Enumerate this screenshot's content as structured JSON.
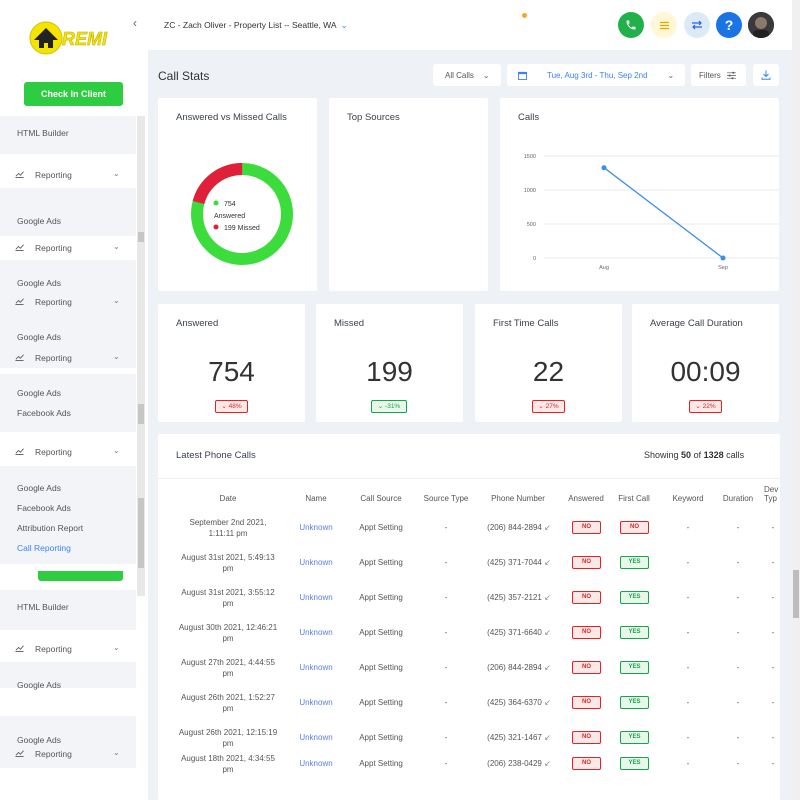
{
  "sidebar": {
    "logo_text": "REMI",
    "check_in_label": "Check In Client",
    "items": [
      {
        "type": "text",
        "label": "HTML Builder"
      },
      {
        "type": "report",
        "label": "Reporting"
      },
      {
        "type": "text",
        "label": "Google Ads"
      },
      {
        "type": "report",
        "label": "Reporting"
      },
      {
        "type": "text",
        "label": "Google Ads"
      },
      {
        "type": "report",
        "label": "Reporting"
      },
      {
        "type": "text",
        "label": "Google Ads"
      },
      {
        "type": "report",
        "label": "Reporting"
      },
      {
        "type": "text",
        "label": "Google Ads"
      },
      {
        "type": "text",
        "label": "Facebook Ads"
      },
      {
        "type": "report",
        "label": "Reporting"
      },
      {
        "type": "text",
        "label": "Google Ads"
      },
      {
        "type": "text",
        "label": "Facebook Ads"
      },
      {
        "type": "text",
        "label": "Attribution Report"
      },
      {
        "type": "text",
        "label": "Call Reporting",
        "active": true
      },
      {
        "type": "text",
        "label": "HTML Builder"
      },
      {
        "type": "report",
        "label": "Reporting"
      },
      {
        "type": "text",
        "label": "Google Ads"
      },
      {
        "type": "text",
        "label": "Google Ads"
      },
      {
        "type": "report",
        "label": "Reporting"
      }
    ]
  },
  "header": {
    "breadcrumb": "ZC - Zach Oliver - Property List -- Seattle, WA",
    "help_label": "?"
  },
  "page": {
    "title": "Call Stats",
    "calls_filter": "All Calls",
    "date_range": "Tue, Aug 3rd - Thu, Sep 2nd",
    "filters_label": "Filters"
  },
  "cards": {
    "answered_vs_missed": {
      "title": "Answered vs Missed Calls",
      "answered_count": "754",
      "answered_label": "Answered",
      "missed_label": "199 Missed",
      "answered_value": 754,
      "missed_value": 199,
      "answered_color": "#3ddc3d",
      "missed_color": "#e0203a"
    },
    "top_sources": {
      "title": "Top Sources"
    },
    "calls": {
      "title": "Calls"
    }
  },
  "chart_data": {
    "type": "line",
    "title": "Calls",
    "x": [
      "Aug",
      "Sep"
    ],
    "series": [
      {
        "values": [
          1328,
          0
        ]
      }
    ],
    "ylim": [
      0,
      1500
    ],
    "yticks": [
      "1500",
      "1000",
      "500",
      "0"
    ],
    "grid": true,
    "line_color": "#3b8fe4"
  },
  "stats": [
    {
      "title": "Answered",
      "value": "754",
      "badge": "⌄ 48%",
      "badge_color": "red"
    },
    {
      "title": "Missed",
      "value": "199",
      "badge": "⌄ -31%",
      "badge_color": "green"
    },
    {
      "title": "First Time Calls",
      "value": "22",
      "badge": "⌄ 27%",
      "badge_color": "red"
    },
    {
      "title": "Average Call Duration",
      "value": "00:09",
      "badge": "⌄ 22%",
      "badge_color": "red"
    }
  ],
  "table": {
    "title": "Latest Phone Calls",
    "showing_prefix": "Showing",
    "showing_count": "50",
    "showing_of": "of",
    "showing_total": "1328",
    "showing_suffix": "calls",
    "headers": [
      "Date",
      "Name",
      "Call Source",
      "Source Type",
      "Phone Number",
      "Answered",
      "First Call",
      "Keyword",
      "Duration",
      "Dev Typ"
    ],
    "rows": [
      {
        "date1": "September 2nd 2021,",
        "date2": "1:11:11 pm",
        "name": "Unknown",
        "source": "Appt Setting",
        "stype": "-",
        "phone": "(206) 844-2894",
        "answered": "NO",
        "first": "NO",
        "keyword": "-",
        "duration": "-",
        "dev": "-"
      },
      {
        "date1": "August 31st 2021, 5:49:13",
        "date2": "pm",
        "name": "Unknown",
        "source": "Appt Setting",
        "stype": "-",
        "phone": "(425) 371-7044",
        "answered": "NO",
        "first": "YES",
        "keyword": "-",
        "duration": "-",
        "dev": "-"
      },
      {
        "date1": "August 31st 2021, 3:55:12",
        "date2": "pm",
        "name": "Unknown",
        "source": "Appt Setting",
        "stype": "-",
        "phone": "(425) 357-2121",
        "answered": "NO",
        "first": "YES",
        "keyword": "-",
        "duration": "-",
        "dev": "-"
      },
      {
        "date1": "August 30th 2021, 12:46:21",
        "date2": "pm",
        "name": "Unknown",
        "source": "Appt Setting",
        "stype": "-",
        "phone": "(425) 371-6640",
        "answered": "NO",
        "first": "YES",
        "keyword": "-",
        "duration": "-",
        "dev": "-"
      },
      {
        "date1": "August 27th 2021, 4:44:55",
        "date2": "pm",
        "name": "Unknown",
        "source": "Appt Setting",
        "stype": "-",
        "phone": "(206) 844-2894",
        "answered": "NO",
        "first": "YES",
        "keyword": "-",
        "duration": "-",
        "dev": "-"
      },
      {
        "date1": "August 26th 2021, 1:52:27",
        "date2": "pm",
        "name": "Unknown",
        "source": "Appt Setting",
        "stype": "-",
        "phone": "(425) 364-6370",
        "answered": "NO",
        "first": "YES",
        "keyword": "-",
        "duration": "-",
        "dev": "-"
      },
      {
        "date1": "August 26th 2021, 12:15:19",
        "date2": "pm",
        "name": "Unknown",
        "source": "Appt Setting",
        "stype": "-",
        "phone": "(425) 321-1467",
        "answered": "NO",
        "first": "YES",
        "keyword": "-",
        "duration": "-",
        "dev": "-"
      },
      {
        "date1": "August 18th 2021, 4:34:55",
        "date2": "pm",
        "name": "Unknown",
        "source": "Appt Setting",
        "stype": "-",
        "phone": "(206) 238-0429",
        "answered": "NO",
        "first": "YES",
        "keyword": "-",
        "duration": "-",
        "dev": "-"
      }
    ]
  }
}
